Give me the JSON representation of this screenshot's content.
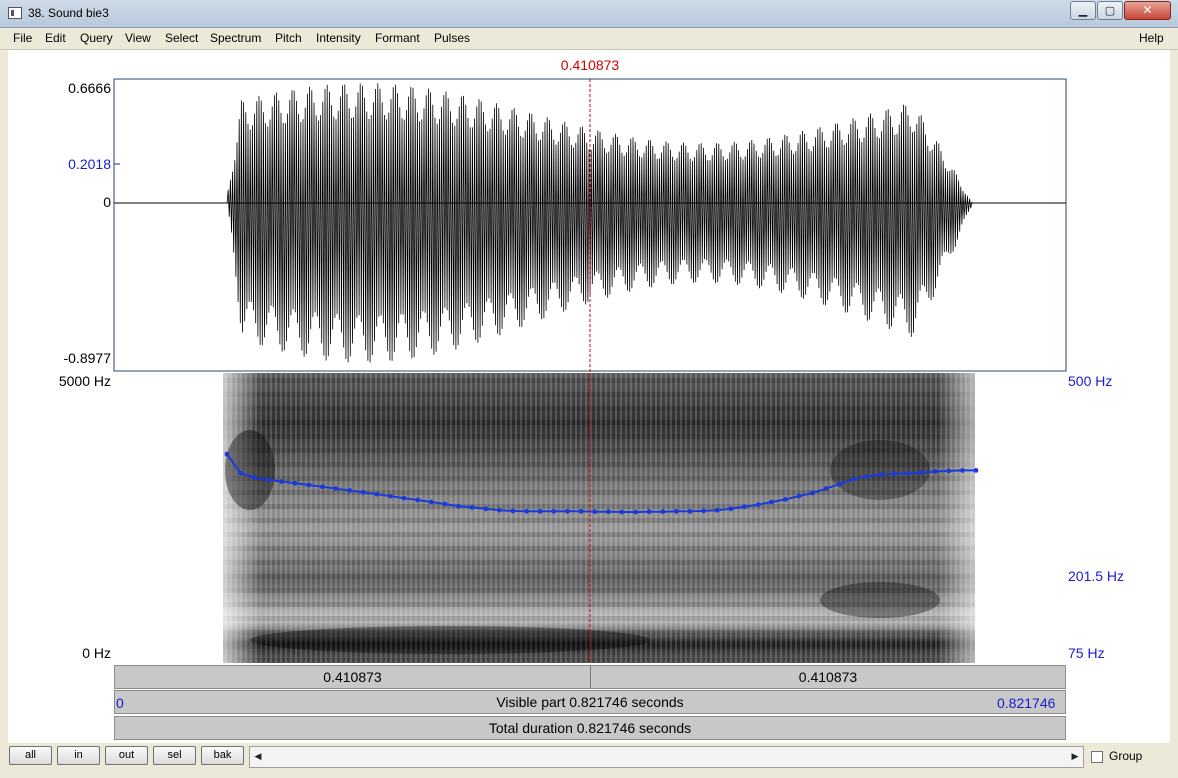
{
  "window": {
    "title": "38. Sound bie3"
  },
  "menu": {
    "items": [
      "File",
      "Edit",
      "Query",
      "View",
      "Select",
      "Spectrum",
      "Pitch",
      "Intensity",
      "Formant",
      "Pulses"
    ],
    "help": "Help"
  },
  "cursor": {
    "time_label": "0.410873",
    "color": "#d40000"
  },
  "waveform": {
    "max_label": "0.6666",
    "cursor_value_label": "0.2018",
    "zero_label": "0",
    "min_label": "-0.8977"
  },
  "spectrogram": {
    "top_label": "5000 Hz",
    "bottom_label": "0 Hz"
  },
  "pitch": {
    "top_label": "500 Hz",
    "cursor_value_label": "201.5 Hz",
    "bottom_label": "75 Hz",
    "color": "#1b3bd8",
    "contour_hz": [
      300,
      263,
      255,
      251,
      248,
      245,
      242,
      239,
      236,
      233,
      230,
      227,
      224,
      221,
      218,
      215,
      212,
      209,
      207,
      205,
      203,
      202,
      201.5,
      201.5,
      201.5,
      201.5,
      201.5,
      201,
      201,
      200.5,
      200.5,
      201,
      201,
      201.5,
      201.5,
      202,
      203,
      205,
      208,
      211,
      215,
      219,
      224,
      229,
      236,
      244,
      252,
      257,
      260,
      262,
      262,
      264,
      266,
      267,
      268,
      268
    ]
  },
  "time_bar": {
    "left_half": "0.410873",
    "right_half": "0.410873",
    "visible_start": "0",
    "visible_part": "Visible part 0.821746 seconds",
    "visible_end": "0.821746",
    "total": "Total duration 0.821746 seconds"
  },
  "toolbar": {
    "all": "all",
    "in": "in",
    "out": "out",
    "sel": "sel",
    "bak": "bak",
    "group": "Group"
  }
}
